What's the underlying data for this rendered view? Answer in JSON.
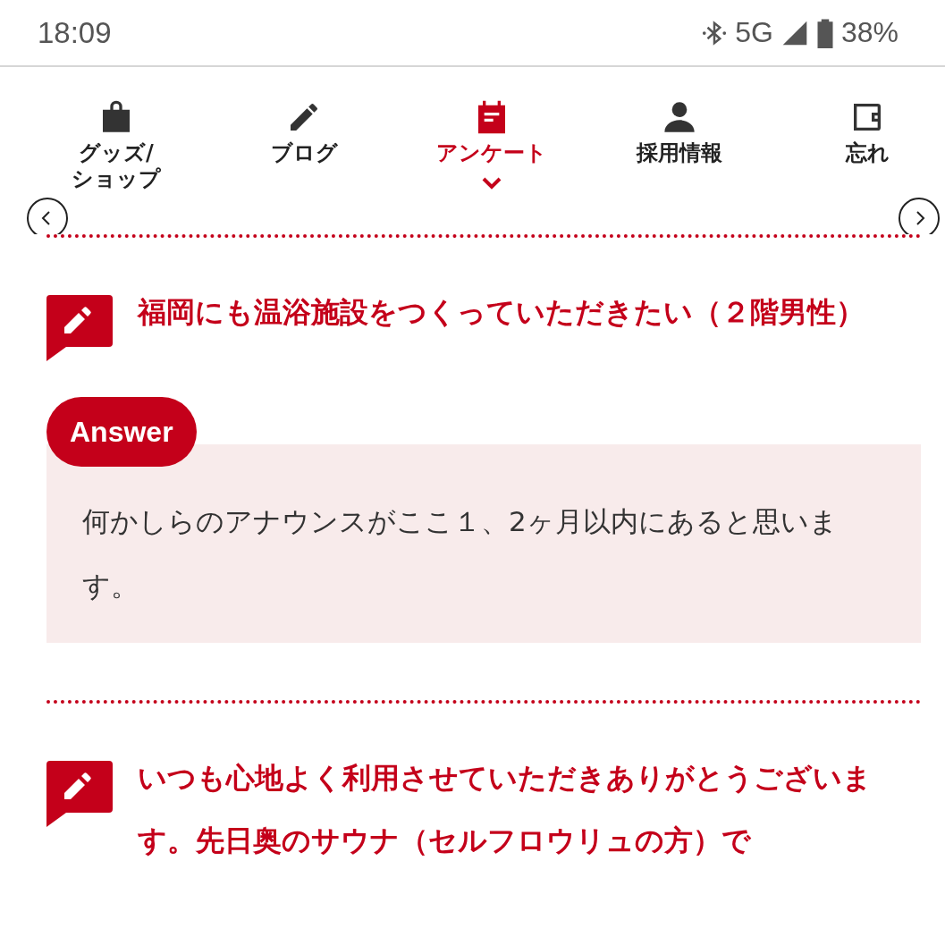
{
  "status_bar": {
    "time": "18:09",
    "network": "5G",
    "battery": "38%"
  },
  "nav": {
    "items": [
      {
        "label": "グッズ/\nショップ",
        "selected": false
      },
      {
        "label": "ブログ",
        "selected": false
      },
      {
        "label": "アンケート",
        "selected": true
      },
      {
        "label": "採用情報",
        "selected": false
      },
      {
        "label": "忘れ",
        "selected": false
      }
    ]
  },
  "questions": [
    {
      "question": "福岡にも温浴施設をつくっていただきたい（２階男性）",
      "answer_label": "Answer",
      "answer": "何かしらのアナウンスがここ１、2ヶ月以内にあると思います。"
    },
    {
      "question": "いつも心地よく利用させていただきありがとうございます。先日奥のサウナ（セルフロウリュの方）で"
    }
  ]
}
